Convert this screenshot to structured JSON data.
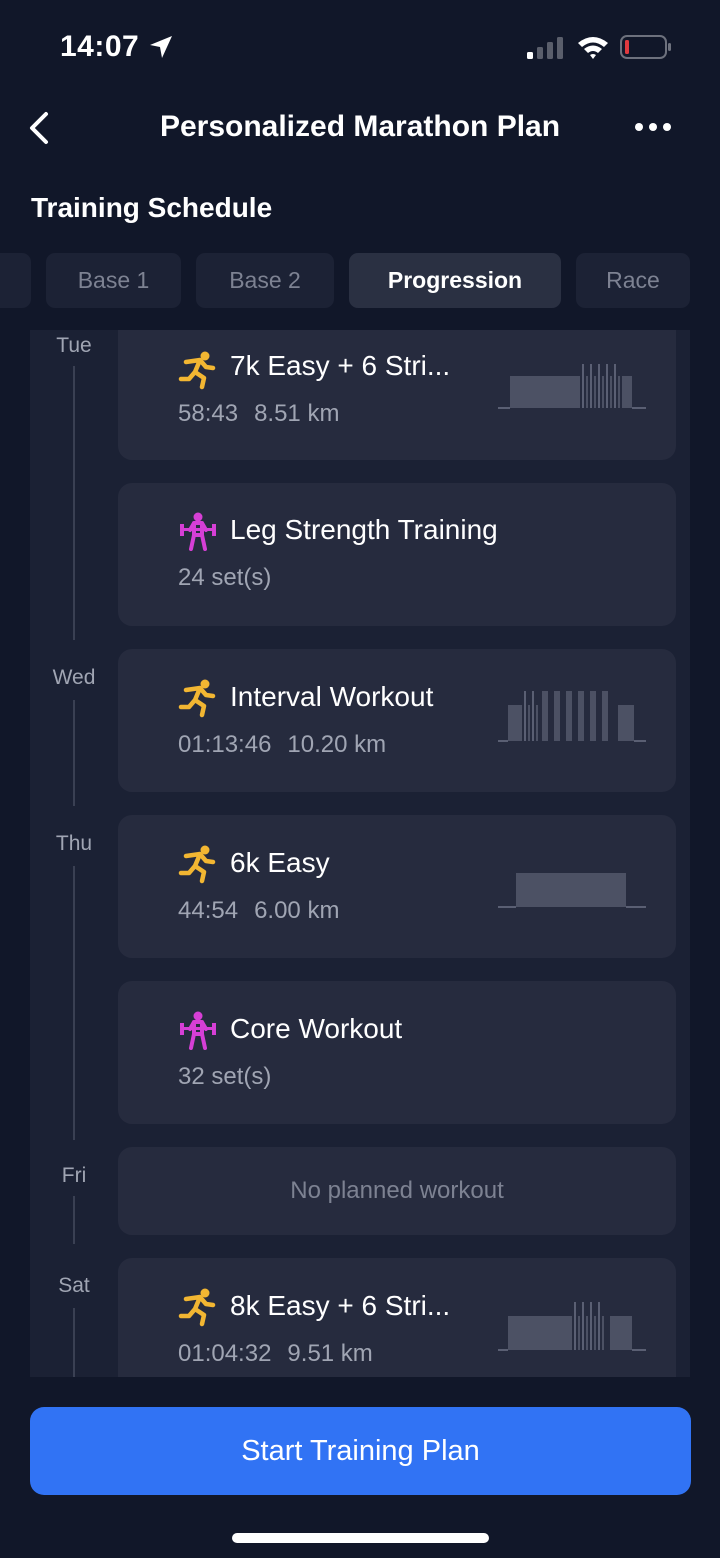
{
  "status_bar": {
    "time": "14:07",
    "icons": [
      "location-arrow-icon",
      "signal-icon",
      "wifi-icon",
      "battery-icon"
    ],
    "battery_color": "#e0393e"
  },
  "nav": {
    "title": "Personalized Marathon Plan",
    "icons": [
      "back-chevron-icon",
      "more-dots-icon"
    ]
  },
  "section": {
    "title": "Training Schedule"
  },
  "tabs": [
    {
      "label": ""
    },
    {
      "label": "Base 1"
    },
    {
      "label": "Base 2"
    },
    {
      "label": "Progression",
      "active": true
    },
    {
      "label": "Race"
    }
  ],
  "schedule": {
    "days": [
      {
        "label": "Tue"
      },
      {
        "label": "Wed"
      },
      {
        "label": "Thu"
      },
      {
        "label": "Fri"
      },
      {
        "label": "Sat"
      }
    ],
    "workouts": [
      {
        "type": "run",
        "icon": "runner-icon",
        "title": "7k Easy + 6 Stri...",
        "duration": "58:43",
        "distance": "8.51 km",
        "graph": "easy-strides"
      },
      {
        "type": "strength",
        "icon": "weightlifter-icon",
        "title": "Leg Strength Training",
        "sets": "24 set(s)"
      },
      {
        "type": "run",
        "icon": "runner-icon",
        "title": "Interval Workout",
        "duration": "01:13:46",
        "distance": "10.20 km",
        "graph": "intervals"
      },
      {
        "type": "run",
        "icon": "runner-icon",
        "title": "6k Easy",
        "duration": "44:54",
        "distance": "6.00 km",
        "graph": "easy"
      },
      {
        "type": "strength",
        "icon": "weightlifter-icon",
        "title": "Core Workout",
        "sets": "32 set(s)"
      },
      {
        "type": "rest",
        "label": "No planned workout"
      },
      {
        "type": "run",
        "icon": "runner-icon",
        "title": "8k Easy + 6 Stri...",
        "duration": "01:04:32",
        "distance": "9.51 km",
        "graph": "easy-strides"
      }
    ]
  },
  "colors": {
    "background": "#111729",
    "card": "#262b3e",
    "run_icon": "#f2b632",
    "strength_icon": "#d63fd6",
    "accent": "#3173f4"
  },
  "start_button": {
    "label": "Start Training Plan"
  }
}
